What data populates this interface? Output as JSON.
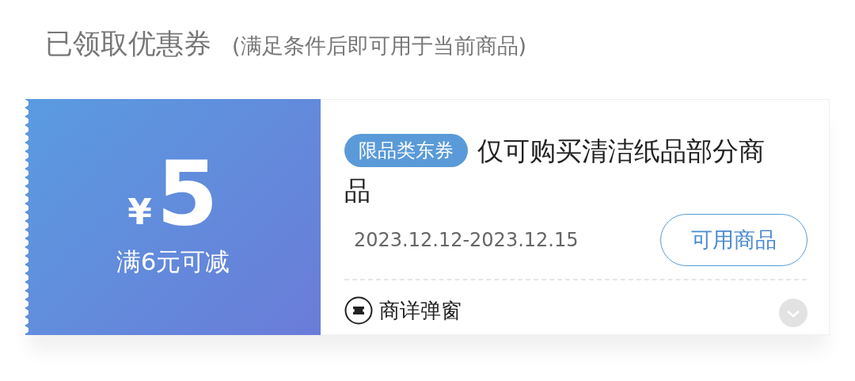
{
  "header": {
    "title": "已领取优惠券",
    "subtitle": "(满足条件后即可用于当前商品)"
  },
  "coupon": {
    "currency": "¥",
    "amount": "5",
    "condition": "满6元可减",
    "tag": "限品类东券",
    "description": "仅可购买清洁纸品部分商品",
    "validity": "2023.12.12-2023.12.15",
    "action_button": "可用商品",
    "footer_label": "商详弹窗"
  }
}
